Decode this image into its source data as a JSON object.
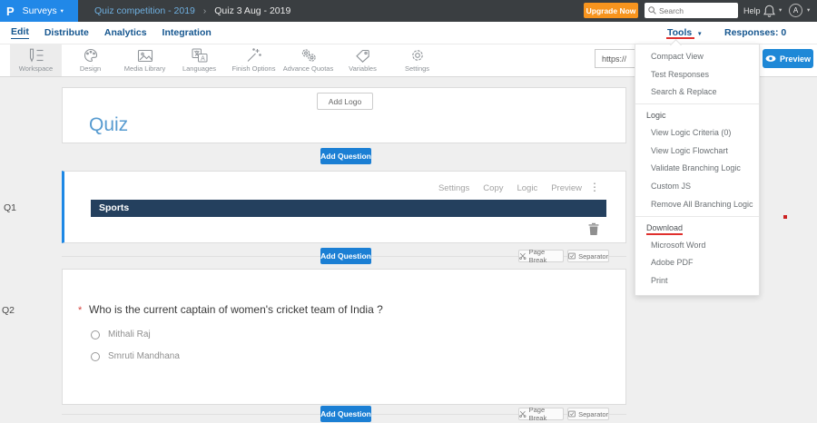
{
  "header": {
    "logo_letter": "P",
    "app_name": "Surveys",
    "breadcrumb": {
      "parent": "Quiz competition - 2019",
      "current": "Quiz 3 Aug - 2019"
    },
    "upgrade_button": "Upgrade Now",
    "search_placeholder": "Search",
    "help": "Help",
    "avatar_initial": "A"
  },
  "nav": {
    "items": [
      {
        "label": "Edit"
      },
      {
        "label": "Distribute"
      },
      {
        "label": "Analytics"
      },
      {
        "label": "Integration"
      }
    ],
    "active": "Edit",
    "tools": "Tools",
    "responses": "Responses: 0"
  },
  "toolbar": {
    "items": [
      {
        "label": "Workspace"
      },
      {
        "label": "Design"
      },
      {
        "label": "Media Library"
      },
      {
        "label": "Languages"
      },
      {
        "label": "Finish Options"
      },
      {
        "label": "Advance Quotas"
      },
      {
        "label": "Variables"
      },
      {
        "label": "Settings"
      }
    ],
    "active_item": "Workspace",
    "url_value": "https://",
    "preview_button": "Preview"
  },
  "tools_menu": {
    "items": [
      "Compact View",
      "Test Responses",
      "Search & Replace"
    ],
    "sections": [
      {
        "header": "Logic",
        "items": [
          "View Logic Criteria (0)",
          "View Logic Flowchart",
          "Validate Branching Logic",
          "Custom JS",
          "Remove All Branching Logic"
        ]
      },
      {
        "header": "Download",
        "items": [
          "Microsoft Word",
          "Adobe PDF",
          "Print"
        ]
      }
    ]
  },
  "canvas": {
    "add_logo": "Add Logo",
    "title": "Quiz",
    "add_question": "Add Question",
    "page_break": "Page Break",
    "separator": "Separator",
    "q1": {
      "label": "Q1",
      "actions": [
        "Settings",
        "Copy",
        "Logic",
        "Preview"
      ],
      "section_title": "Sports"
    },
    "q2": {
      "label": "Q2",
      "required": "*",
      "question": "Who is the current captain of women's cricket team of India ?",
      "options": [
        "Mithali Raj",
        "Smruti Mandhana"
      ]
    }
  },
  "icons": {
    "chevron_down": "▾",
    "kebab": "⋮",
    "breadcrumb_sep": "›"
  },
  "colors": {
    "brand_blue": "#2188e8",
    "header_dark": "#3a3e41",
    "accent_orange": "#f7941e",
    "nav_blue": "#15568f",
    "button_blue": "#1b7fd4",
    "section_navy": "#24405e",
    "title_blue": "#579bd0",
    "annotation_red": "#e0302d"
  }
}
